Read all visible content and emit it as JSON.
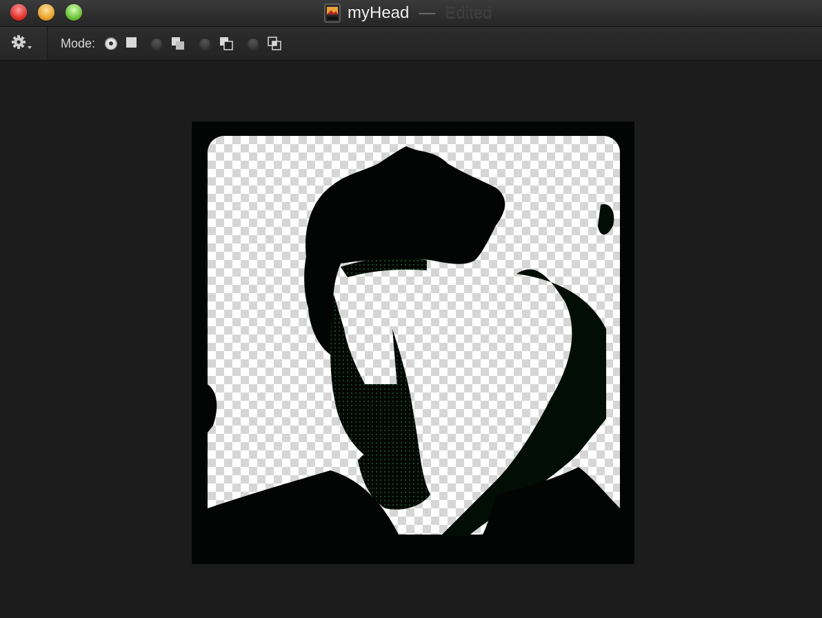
{
  "window": {
    "title": "myHead",
    "separator": "—",
    "status": "Edited"
  },
  "toolbar": {
    "settings_icon": "gear-icon",
    "mode_label": "Mode:",
    "modes": [
      {
        "icon": "square-mode-icon",
        "selected": true
      },
      {
        "icon": "overlap-mode-icon",
        "selected": false
      },
      {
        "icon": "subtract-mode-icon",
        "selected": false
      },
      {
        "icon": "intersect-mode-icon",
        "selected": false
      }
    ]
  },
  "canvas": {
    "image_subject": "halftone portrait",
    "background": "transparency-checkerboard"
  },
  "colors": {
    "window_bg": "#1c1c1c",
    "image_dark": "#020503",
    "halftone_tint": "#0d2a12"
  }
}
